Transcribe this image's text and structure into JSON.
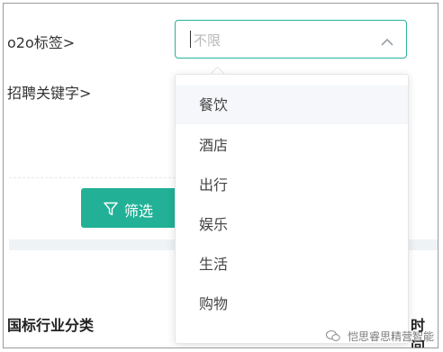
{
  "form": {
    "o2o_label": "o2o标签>",
    "keyword_label": "招聘关键字>",
    "industry_label": "国标行业分类",
    "right_partial_label": "时间"
  },
  "select": {
    "placeholder": "不限",
    "icon": "chevron-up-icon",
    "border_color": "#27b29a"
  },
  "dropdown": {
    "options": [
      "餐饮",
      "酒店",
      "出行",
      "娱乐",
      "生活",
      "购物"
    ],
    "hovered_index": 0
  },
  "filter_button": {
    "label": "筛选",
    "icon": "filter-icon",
    "color": "#22b196"
  },
  "watermark": {
    "text": "恺思睿思精营智能",
    "icon": "wechat-icon"
  }
}
